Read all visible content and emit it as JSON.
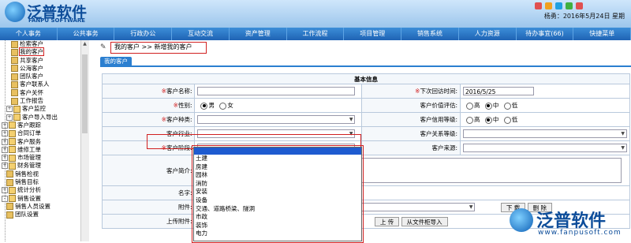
{
  "header": {
    "logo_cn": "泛普软件",
    "logo_en": "FANPU SOFTWARE",
    "user_info": "杨勇：2016年5月24日 星期"
  },
  "nav": [
    "个人事务",
    "公共事务",
    "行政办公",
    "互动交流",
    "资产管理",
    "工作流程",
    "项目管理",
    "销售系统",
    "人力资源",
    "待办事宜(66)",
    "快捷菜单"
  ],
  "sidebar": {
    "items": [
      {
        "label": "检索客户",
        "indent": 2,
        "exp": ""
      },
      {
        "label": "我的客户",
        "indent": 2,
        "exp": "",
        "selected": true
      },
      {
        "label": "共享客户",
        "indent": 2,
        "exp": ""
      },
      {
        "label": "公海客户",
        "indent": 2,
        "exp": ""
      },
      {
        "label": "团队客户",
        "indent": 2,
        "exp": ""
      },
      {
        "label": "客户联系人",
        "indent": 2,
        "exp": ""
      },
      {
        "label": "客户关怀",
        "indent": 2,
        "exp": ""
      },
      {
        "label": "工作报告",
        "indent": 2,
        "exp": ""
      },
      {
        "label": "客户监控",
        "indent": 1,
        "exp": "+"
      },
      {
        "label": "客户导入导出",
        "indent": 1,
        "exp": "+"
      },
      {
        "label": "客户跟踪",
        "indent": 0,
        "exp": "+"
      },
      {
        "label": "合同订单",
        "indent": 0,
        "exp": "+"
      },
      {
        "label": "客户服务",
        "indent": 0,
        "exp": "+"
      },
      {
        "label": "维修工单",
        "indent": 0,
        "exp": "+"
      },
      {
        "label": "市场管理",
        "indent": 0,
        "exp": "+"
      },
      {
        "label": "财务管理",
        "indent": 0,
        "exp": "+"
      },
      {
        "label": "销售检视",
        "indent": 1,
        "exp": ""
      },
      {
        "label": "销售目标",
        "indent": 1,
        "exp": ""
      },
      {
        "label": "统计分析",
        "indent": 0,
        "exp": "+"
      },
      {
        "label": "销售设置",
        "indent": 0,
        "exp": "-"
      },
      {
        "label": "销售人员设置",
        "indent": 1,
        "exp": ""
      },
      {
        "label": "团队设置",
        "indent": 1,
        "exp": ""
      }
    ]
  },
  "breadcrumb": {
    "part1": "我的客户",
    "sep": ">>",
    "part2": "新增我的客户"
  },
  "tab": "我的客户",
  "form": {
    "section": "基本信息",
    "customer_name": "客户名称:",
    "next_visit": "下次回访时间:",
    "next_visit_value": "2016/5/25",
    "gender": "性别:",
    "male": "男",
    "female": "女",
    "value_rating": "客户价值评估:",
    "high": "高",
    "mid": "中",
    "low": "低",
    "category": "客户种类:",
    "credit_level": "客户信用等级:",
    "industry": "客户行业:",
    "relation_level": "客户关系等级:",
    "stage": "客户阶段:",
    "source": "客户来源:",
    "intro": "客户简介:",
    "name": "名字:",
    "attachment": "附件:",
    "download": "下 载",
    "delete": "删 除",
    "upload_attachment": "上传附件:",
    "upload": "上 传",
    "upload_from_group": "从文件柜导入"
  },
  "dropdown": {
    "options": [
      "",
      "土建",
      "房建",
      "园林",
      "消防",
      "安装",
      "设备",
      "交通、道路桥梁、隧洞",
      "市政",
      "装饰",
      "电力"
    ]
  },
  "watermark": {
    "cn": "泛普软件",
    "url": "www.fanpusoft.com"
  },
  "colors": {
    "nav_bg": "#1f63b4",
    "accent": "#2b7fd0",
    "required": "#d02020",
    "highlight": "#1e5bd0"
  }
}
